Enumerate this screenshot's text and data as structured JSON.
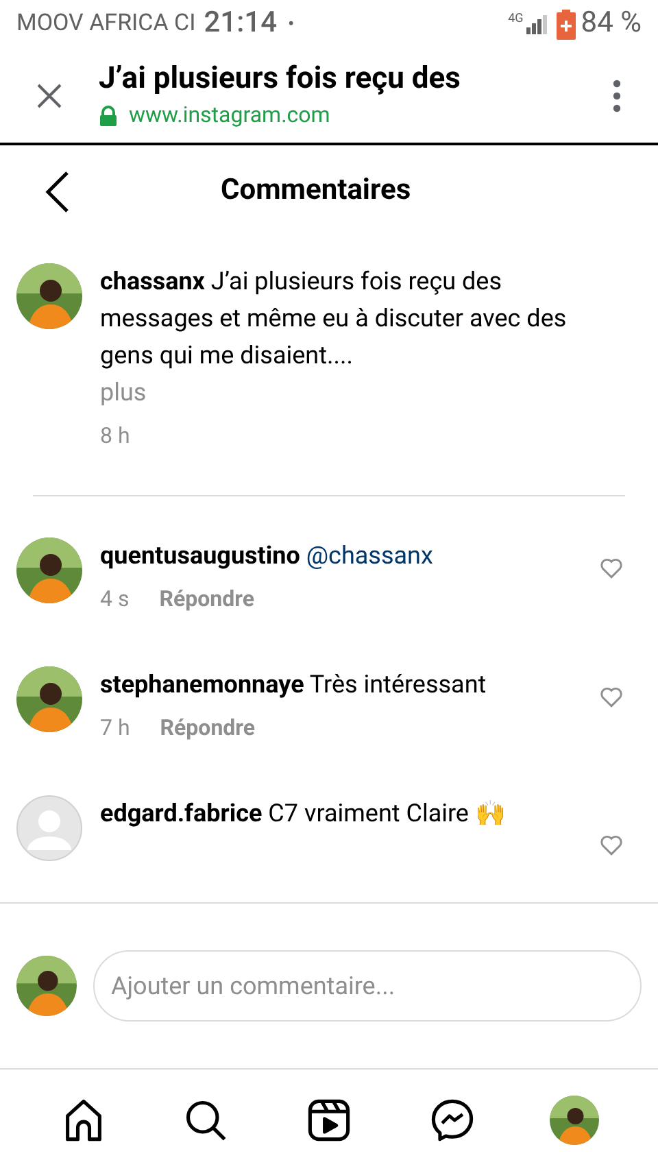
{
  "status_bar": {
    "carrier": "MOOV AFRICA CI",
    "time": "21:14",
    "dot": "•",
    "network": "4G",
    "battery": "84 %"
  },
  "browser_bar": {
    "title": "J’ai plusieurs fois reçu des",
    "url": "www.instagram.com"
  },
  "header": {
    "title": "Commentaires"
  },
  "caption": {
    "username": "chassanx",
    "text": "J’ai plusieurs fois reçu des messages et même eu à discuter avec des gens qui me disaient....",
    "more": "plus",
    "time": "8 h"
  },
  "comments": [
    {
      "kind": "photo",
      "username": "quentusaugustino",
      "text": "@chassanx",
      "mention": true,
      "time": "4 s",
      "reply": "Répondre"
    },
    {
      "kind": "photo",
      "username": "stephanemonnaye",
      "text": "Très intéressant",
      "mention": false,
      "time": "7 h",
      "reply": "Répondre"
    },
    {
      "kind": "default",
      "username": "edgard.fabrice",
      "text": "C7 vraiment Claire 🙌",
      "mention": false
    }
  ],
  "composer": {
    "placeholder": "Ajouter un commentaire..."
  }
}
